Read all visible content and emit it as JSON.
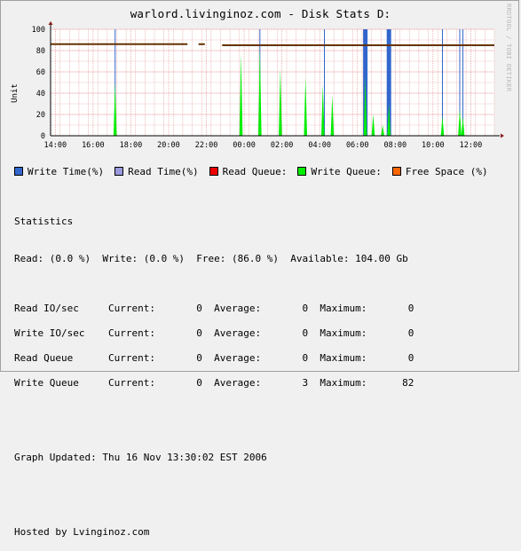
{
  "title": "warlord.livinginoz.com - Disk Stats D:",
  "watermark": "RRDTOOL / TOBI OETIKER",
  "chart_data": {
    "type": "area",
    "ylabel": "Unit",
    "xlabel": "",
    "ylim": [
      0,
      100
    ],
    "yticks": [
      0,
      20,
      40,
      60,
      80,
      100
    ],
    "x_range_hours": [
      13.75,
      13.25
    ],
    "xticks": [
      "14:00",
      "16:00",
      "18:00",
      "20:00",
      "22:00",
      "00:00",
      "02:00",
      "04:00",
      "06:00",
      "08:00",
      "10:00",
      "12:00"
    ],
    "grid": true,
    "legend": [
      "Write Time(%)",
      "Read Time(%)",
      "Read Queue:",
      "Write Queue:",
      "Free Space (%)"
    ],
    "series": [
      {
        "name": "Write Time(%)",
        "color": "#3366cc",
        "spikes": [
          {
            "time": "17:10",
            "value": 100
          },
          {
            "time": "00:50",
            "value": 100
          },
          {
            "time": "04:15",
            "value": 100
          },
          {
            "time": "06:25",
            "value": 100,
            "wide": true
          },
          {
            "time": "07:40",
            "value": 100,
            "wide": true
          },
          {
            "time": "10:30",
            "value": 100
          },
          {
            "time": "11:25",
            "value": 100
          },
          {
            "time": "11:35",
            "value": 100
          }
        ]
      },
      {
        "name": "Read Time(%)",
        "color": "#9999dd",
        "spikes": []
      },
      {
        "name": "Read Queue:",
        "color": "#ee0000",
        "spikes": []
      },
      {
        "name": "Write Queue:",
        "color": "#00ee00",
        "spikes": [
          {
            "time": "17:10",
            "value": 50
          },
          {
            "time": "23:50",
            "value": 77
          },
          {
            "time": "00:50",
            "value": 83
          },
          {
            "time": "01:55",
            "value": 63
          },
          {
            "time": "03:15",
            "value": 55
          },
          {
            "time": "04:10",
            "value": 48
          },
          {
            "time": "04:40",
            "value": 38
          },
          {
            "time": "06:25",
            "value": 55
          },
          {
            "time": "06:50",
            "value": 20
          },
          {
            "time": "07:20",
            "value": 10
          },
          {
            "time": "07:40",
            "value": 30
          },
          {
            "time": "10:30",
            "value": 18
          },
          {
            "time": "11:25",
            "value": 25
          },
          {
            "time": "11:35",
            "value": 18
          }
        ]
      },
      {
        "name": "Free Space (%)",
        "color": "#663300",
        "segments": [
          {
            "start": "13:45",
            "end": "21:00",
            "value": 86
          },
          {
            "start": "21:35",
            "end": "21:55",
            "value": 86
          },
          {
            "start": "22:50",
            "end": "13:15",
            "value": 85
          }
        ]
      }
    ]
  },
  "legend_colors": [
    "#3366cc",
    "#9999dd",
    "#ee0000",
    "#00ee00",
    "#ff6600"
  ],
  "stats": {
    "heading": "Statistics",
    "summary": "Read: (0.0 %)  Write: (0.0 %)  Free: (86.0 %)  Available: 104.00 Gb",
    "rows": [
      {
        "label": "Read IO/sec",
        "current": "0",
        "average": "0",
        "maximum": "0"
      },
      {
        "label": "Write IO/sec",
        "current": "0",
        "average": "0",
        "maximum": "0"
      },
      {
        "label": "Read Queue",
        "current": "0",
        "average": "0",
        "maximum": "0"
      },
      {
        "label": "Write Queue",
        "current": "0",
        "average": "3",
        "maximum": "82"
      }
    ],
    "current_label": "Current:",
    "average_label": "Average:",
    "maximum_label": "Maximum:",
    "updated": "Graph Updated: Thu 16 Nov 13:30:02 EST 2006",
    "hosted": "Hosted by Lvinginoz.com"
  }
}
